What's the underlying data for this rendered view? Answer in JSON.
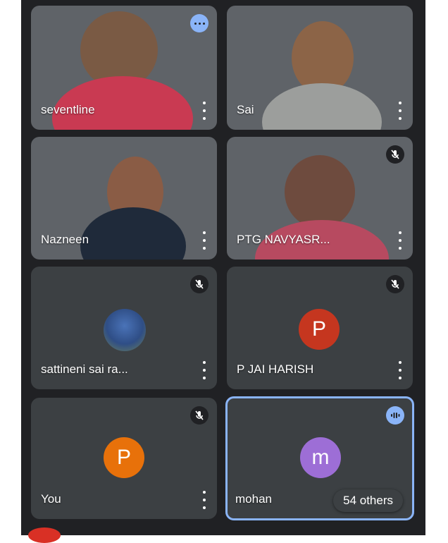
{
  "participants": [
    {
      "name": "seventline",
      "badge": "more-options-icon"
    },
    {
      "name": "Sai"
    },
    {
      "name": "Nazneen"
    },
    {
      "name": "PTG NAVYASR...",
      "badge": "mic-off-icon"
    },
    {
      "name": "sattineni sai ra...",
      "badge": "mic-off-icon"
    },
    {
      "name": "P JAI HARISH",
      "badge": "mic-off-icon",
      "avatar_letter": "P",
      "avatar_color": "#c5361f"
    },
    {
      "name": "You",
      "badge": "mic-off-icon",
      "avatar_letter": "P",
      "avatar_color": "#e8710a"
    },
    {
      "name": "mohan",
      "badge": "audio-active-icon",
      "avatar_letter": "m",
      "avatar_color": "#9d6ed6"
    }
  ],
  "others_label": "54 others",
  "colors": {
    "background": "#202124",
    "tile": "#3c4043",
    "active_border": "#8ab4f8"
  }
}
